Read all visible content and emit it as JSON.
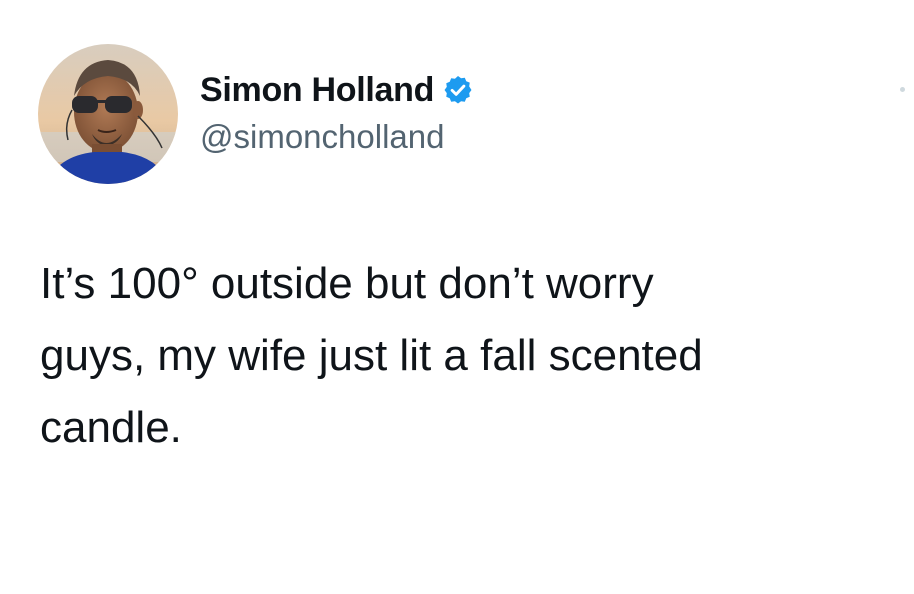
{
  "tweet": {
    "author": {
      "name": "Simon Holland",
      "handle": "@simoncholland",
      "verified": true,
      "avatar": "profile-photo"
    },
    "text": "It’s 100° outside but don’t worry\nguys, my wife just lit a fall scented\ncandle."
  },
  "colors": {
    "text": "#0f1419",
    "secondary_text": "#536471",
    "verified_blue": "#1d9bf0",
    "background": "#ffffff"
  },
  "icons": {
    "verified": "verified-badge-icon",
    "more": "more-options-icon"
  }
}
